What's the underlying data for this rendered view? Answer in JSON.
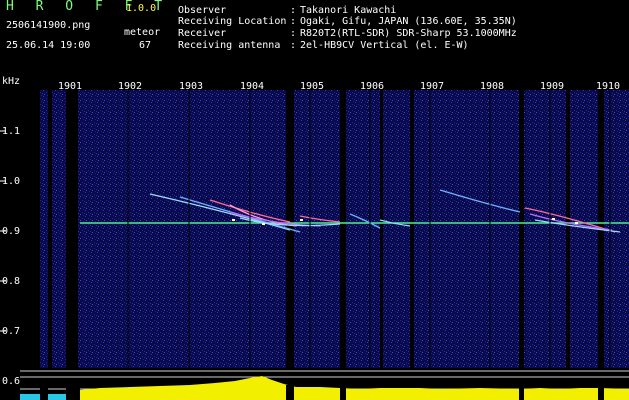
{
  "header": {
    "title": "H R O F F T",
    "version": "1.0.0",
    "filename": "2506141900.png",
    "datetime": "25.06.14 19:00",
    "meteor_label": "meteor",
    "meteor_count": "67"
  },
  "info": [
    {
      "label": "Observer",
      "value": "Takanori Kawachi"
    },
    {
      "label": "Receiving Location",
      "value": "Ogaki, Gifu, JAPAN (136.60E, 35.35N)"
    },
    {
      "label": "Receiver",
      "value": "R820T2(RTL-SDR) SDR-Sharp 53.1000MHz"
    },
    {
      "label": "Receiving antenna",
      "value": "2el-HB9CV Vertical (el. E-W)"
    }
  ],
  "colon": ":",
  "axis": {
    "unit": "kHz",
    "y_ticks": [
      "1.1",
      "1.0",
      "0.9",
      "0.8",
      "0.7",
      "0.6"
    ],
    "x_ticks": [
      "1901",
      "1902",
      "1903",
      "1904",
      "1905",
      "1906",
      "1907",
      "1908",
      "1909",
      "1910"
    ]
  },
  "colors": {
    "background": "#000000",
    "spectrum_bg": "#0a0a4a",
    "carrier": "#4cf08c",
    "power_fill": "#f2f000",
    "power_base": "#29c8e6",
    "label_white": "#ffffff",
    "label_green": "#7dfc7d",
    "label_yellow": "#fff84a"
  }
}
